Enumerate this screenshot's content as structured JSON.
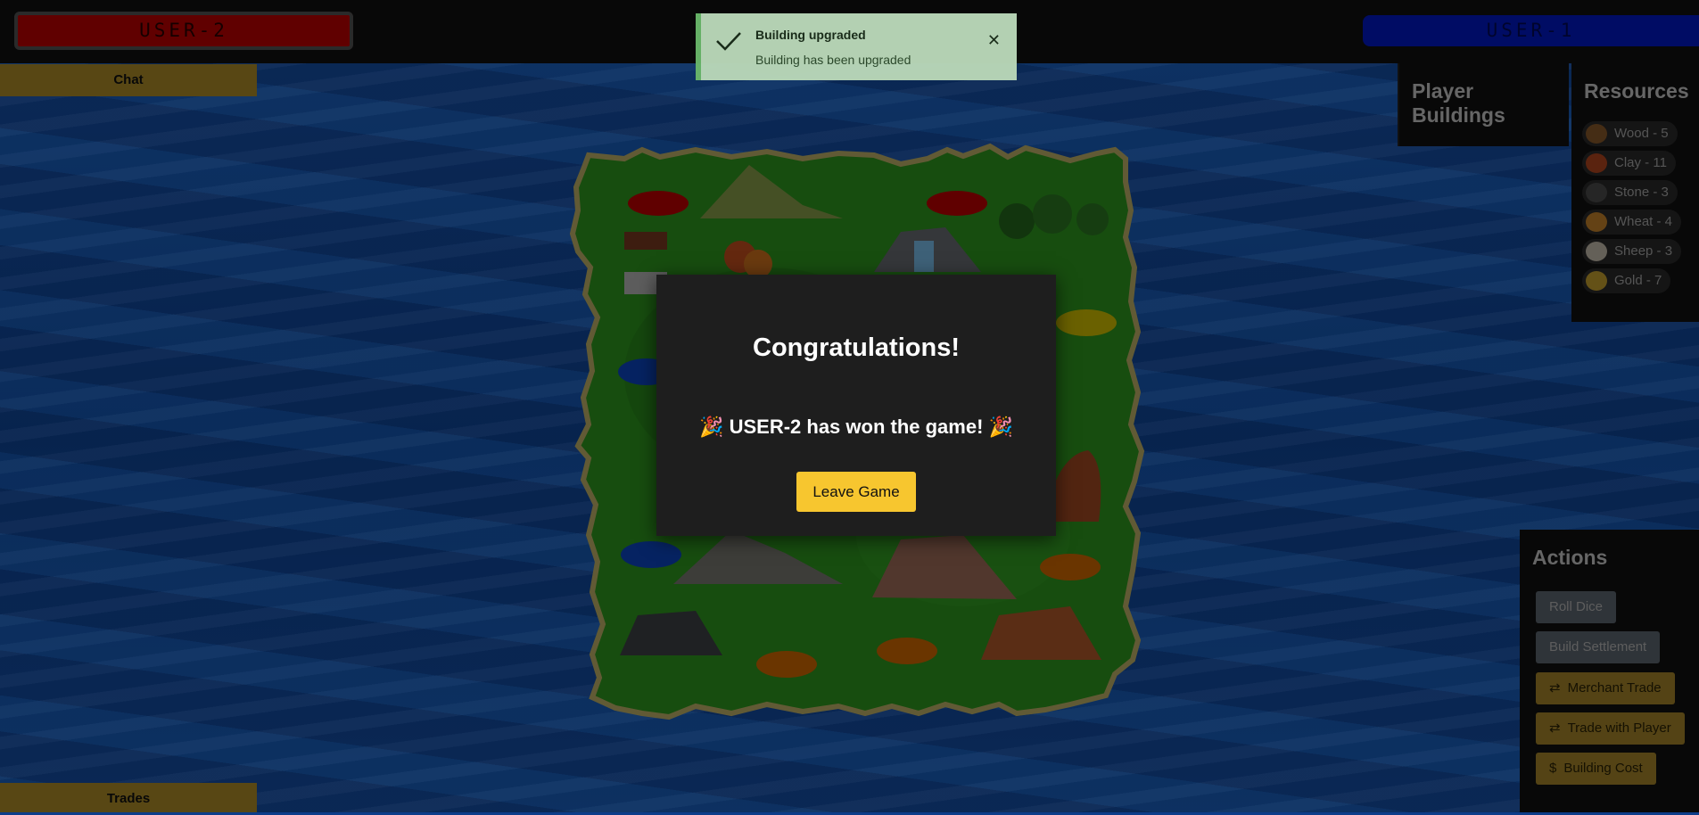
{
  "players": {
    "left": {
      "name": "USER-2",
      "color": "#c00000"
    },
    "right": {
      "name": "USER-1",
      "color": "#0018c8"
    }
  },
  "side_buttons": {
    "chat": "Chat",
    "trades": "Trades"
  },
  "toast": {
    "title": "Building upgraded",
    "message": "Building has been upgraded",
    "icon": "check-icon"
  },
  "modal": {
    "title": "Congratulations!",
    "message": "🎉 USER-2 has won the game! 🎉",
    "leave_label": "Leave Game"
  },
  "player_buildings": {
    "title": "Player Buildings"
  },
  "resources": {
    "title": "Resources",
    "items": [
      {
        "label": "Wood - 5",
        "icon": "wood-icon",
        "color": "#8b5a2b"
      },
      {
        "label": "Clay - 11",
        "icon": "clay-icon",
        "color": "#b5461f"
      },
      {
        "label": "Stone - 3",
        "icon": "stone-icon",
        "color": "#4c4c4c"
      },
      {
        "label": "Wheat - 4",
        "icon": "wheat-icon",
        "color": "#c8842a"
      },
      {
        "label": "Sheep - 3",
        "icon": "sheep-icon",
        "color": "#c9c0b0"
      },
      {
        "label": "Gold - 7",
        "icon": "gold-icon",
        "color": "#c8a22f"
      }
    ]
  },
  "actions": {
    "title": "Actions",
    "buttons": [
      {
        "label": "Roll Dice",
        "style": "grey",
        "icon": ""
      },
      {
        "label": "Build Settlement",
        "style": "grey",
        "icon": ""
      },
      {
        "label": "Merchant Trade",
        "style": "gold",
        "icon": "swap-icon"
      },
      {
        "label": "Trade with Player",
        "style": "gold",
        "icon": "swap-icon"
      },
      {
        "label": "Building Cost",
        "style": "gold",
        "icon": "dollar-icon"
      }
    ]
  },
  "colors": {
    "accent": "#f7c62f",
    "panel": "#111111",
    "ocean": "#1456b5",
    "island": "#2e9a1e"
  }
}
